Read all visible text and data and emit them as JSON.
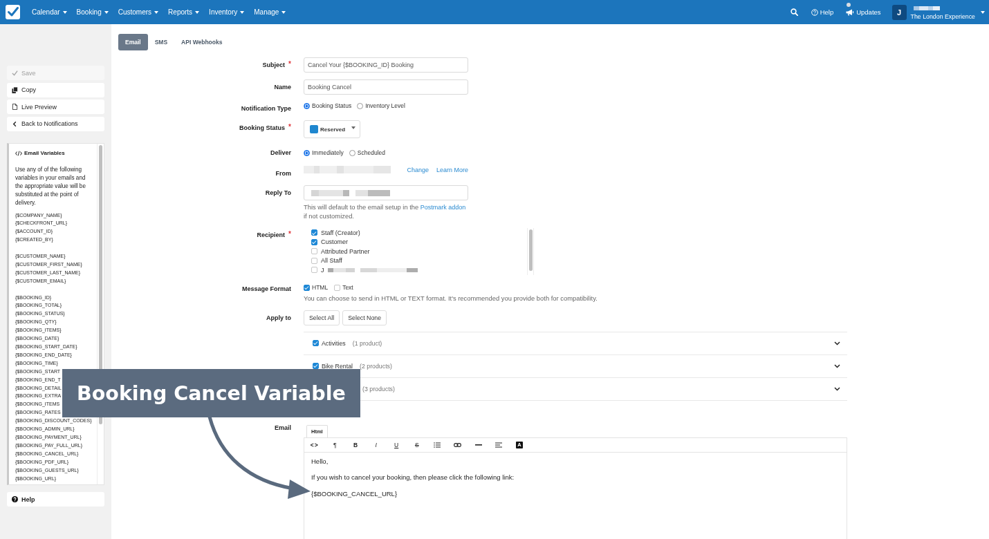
{
  "topbar": {
    "menus": [
      {
        "label": "Calendar"
      },
      {
        "label": "Booking"
      },
      {
        "label": "Customers"
      },
      {
        "label": "Reports"
      },
      {
        "label": "Inventory"
      },
      {
        "label": "Manage"
      }
    ],
    "help": "Help",
    "updates": "Updates",
    "avatar": "J",
    "account": "The London Experience"
  },
  "sidebar": {
    "actions": [
      {
        "kind": "save",
        "label": "Save",
        "disabled": true
      },
      {
        "kind": "copy",
        "label": "Copy",
        "disabled": false
      },
      {
        "kind": "preview",
        "label": "Live Preview",
        "disabled": false
      },
      {
        "kind": "back",
        "label": "Back to Notifications",
        "disabled": false
      }
    ],
    "variables_panel": {
      "title": "Email Variables",
      "intro": "Use any of of the following variables in your emails and the appropriate value will be substituted at the point of delivery.",
      "groups": [
        [
          "{$COMPANY_NAME}",
          "{$CHECKFRONT_URL}",
          "{$ACCOUNT_ID}",
          "{$CREATED_BY}"
        ],
        [
          "{$CUSTOMER_NAME}",
          "{$CUSTOMER_FIRST_NAME}",
          "{$CUSTOMER_LAST_NAME}",
          "{$CUSTOMER_EMAIL}"
        ],
        [
          "{$BOOKING_ID}",
          "{$BOOKING_TOTAL}",
          "{$BOOKING_STATUS}",
          "{$BOOKING_QTY}",
          "{$BOOKING_ITEMS}",
          "{$BOOKING_DATE}",
          "{$BOOKING_START_DATE}",
          "{$BOOKING_END_DATE}",
          "{$BOOKING_TIME}",
          "{$BOOKING_START",
          "{$BOOKING_END_T",
          "{$BOOKING_DETAIL",
          "{$BOOKING_EXTRA",
          "{$BOOKING_ITEMS",
          "{$BOOKING_RATES",
          "{$BOOKING_DISCOUNT_CODES}",
          "{$BOOKING_ADMIN_URL}",
          "{$BOOKING_PAYMENT_URL}",
          "{$BOOKING_PAY_FULL_URL}",
          "{$BOOKING_CANCEL_URL}",
          "{$BOOKING_PDF_URL}",
          "{$BOOKING_GUESTS_URL}",
          "{$BOOKING_URL}"
        ]
      ]
    },
    "help": "Help"
  },
  "tabs": [
    {
      "label": "Email",
      "selected": true
    },
    {
      "label": "SMS",
      "selected": false
    },
    {
      "label": "API Webhooks",
      "selected": false
    }
  ],
  "form": {
    "subject": {
      "label": "Subject",
      "required_mark": "*",
      "value": "Cancel Your {$BOOKING_ID} Booking"
    },
    "name": {
      "label": "Name",
      "value": "Booking Cancel"
    },
    "notification_type": {
      "label": "Notification Type",
      "options": [
        {
          "label": "Booking Status",
          "selected": true
        },
        {
          "label": "Inventory Level",
          "selected": false
        }
      ]
    },
    "booking_status": {
      "label": "Booking Status",
      "required_mark": "*",
      "value": "Reserved",
      "color": "#1f87cf"
    },
    "deliver": {
      "label": "Deliver",
      "options": [
        {
          "label": "Immediately",
          "selected": true
        },
        {
          "label": "Scheduled",
          "selected": false
        }
      ]
    },
    "from": {
      "label": "From",
      "links": [
        "Change",
        "Learn More"
      ]
    },
    "reply_to": {
      "label": "Reply To",
      "help_before": "This will default to the email setup in the",
      "help_link": "Postmark addon",
      "help_after": "if not customized."
    },
    "recipient": {
      "label": "Recipient",
      "required_mark": "*",
      "options": [
        {
          "label": "Staff (Creator)",
          "checked": true,
          "redacted": false
        },
        {
          "label": "Customer",
          "checked": true,
          "redacted": false
        },
        {
          "label": "Attributed Partner",
          "checked": false,
          "redacted": false
        },
        {
          "label": "All Staff",
          "checked": false,
          "redacted": false
        },
        {
          "label": "J",
          "checked": false,
          "redacted": true
        }
      ]
    },
    "message_format": {
      "label": "Message Format",
      "options": [
        {
          "label": "HTML",
          "checked": true
        },
        {
          "label": "Text",
          "checked": false
        }
      ],
      "help": "You can choose to send in HTML or TEXT format. It's recommended you provide both for compatibility."
    },
    "apply_to": {
      "label": "Apply to",
      "buttons": [
        "Select All",
        "Select None"
      ],
      "categories": [
        {
          "name": "Activities",
          "count": "(1 product)",
          "checked": true
        },
        {
          "name": "Bike Rental",
          "count": "(2 products)",
          "checked": true
        },
        {
          "count": "(3 products)"
        }
      ]
    },
    "email": {
      "label": "Email",
      "tab": "Html",
      "toolbar": [
        {
          "kind": "code",
          "label": "<>"
        },
        {
          "kind": "paragraph",
          "label": "¶"
        },
        {
          "kind": "bold",
          "label": "B"
        },
        {
          "kind": "italic",
          "label": "I"
        },
        {
          "kind": "underline",
          "label": "U"
        },
        {
          "kind": "strikethrough",
          "label": "S"
        },
        {
          "kind": "list"
        },
        {
          "kind": "link"
        },
        {
          "kind": "rule"
        },
        {
          "kind": "align"
        },
        {
          "kind": "text_color",
          "label": "A"
        }
      ],
      "body": [
        "Hello,",
        "If you wish to cancel your booking, then please click the following link:",
        "{$BOOKING_CANCEL_URL}"
      ]
    }
  },
  "callout": {
    "text": "Booking Cancel Variable"
  }
}
